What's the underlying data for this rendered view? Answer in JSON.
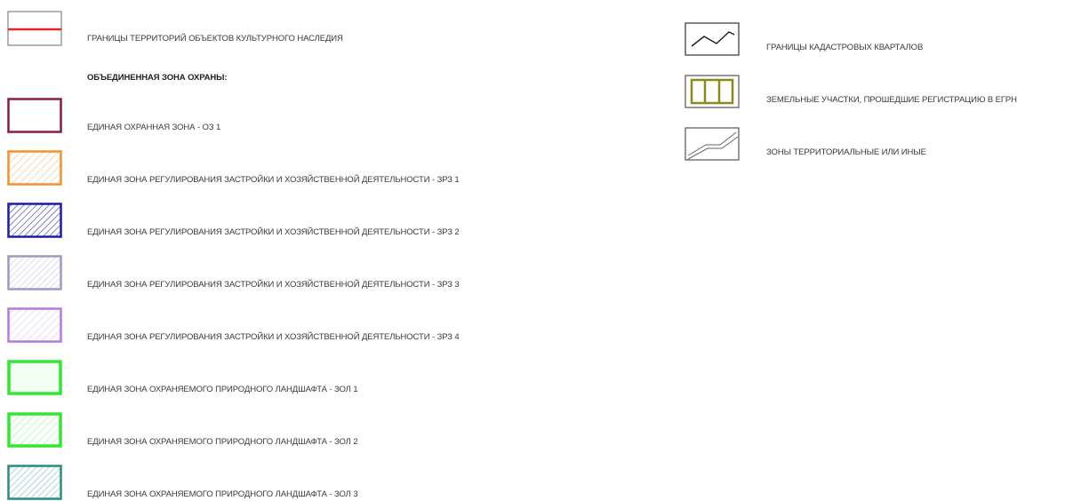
{
  "legend": {
    "heading": "ОБЪЕДИНЕННАЯ ЗОНА ОХРАНЫ:",
    "left_items": [
      {
        "label": "ГРАНИЦЫ ТЕРРИТОРИЙ ОБЪЕКТОВ КУЛЬТУРНОГО НАСЛЕДИЯ",
        "symbol": "red-line-boundary",
        "color": "#e4262b"
      },
      {
        "label": "ЕДИНАЯ ОХРАННАЯ ЗОНА - ОЗ 1",
        "symbol": "outlined-box",
        "color": "#8b1a4a"
      },
      {
        "label": "ЕДИНАЯ ЗОНА РЕГУЛИРОВАНИЯ ЗАСТРОЙКИ И ХОЗЯЙСТВЕННОЙ ДЕЯТЕЛЬНОСТИ - ЗРЗ 1",
        "symbol": "hatched-box",
        "color": "#f0922e"
      },
      {
        "label": "ЕДИНАЯ ЗОНА РЕГУЛИРОВАНИЯ ЗАСТРОЙКИ И ХОЗЯЙСТВЕННОЙ ДЕЯТЕЛЬНОСТИ - ЗРЗ 2",
        "symbol": "hatched-box",
        "color": "#1c1ca8"
      },
      {
        "label": "ЕДИНАЯ ЗОНА РЕГУЛИРОВАНИЯ ЗАСТРОЙКИ И ХОЗЯЙСТВЕННОЙ ДЕЯТЕЛЬНОСТИ - ЗРЗ 3",
        "symbol": "hatched-box",
        "color": "#9a9ac4"
      },
      {
        "label": "ЕДИНАЯ ЗОНА РЕГУЛИРОВАНИЯ ЗАСТРОЙКИ И ХОЗЯЙСТВЕННОЙ ДЕЯТЕЛЬНОСТИ - ЗРЗ 4",
        "symbol": "hatched-box",
        "color": "#b27ae0"
      },
      {
        "label": "ЕДИНАЯ ЗОНА ОХРАНЯЕМОГО ПРИРОДНОГО ЛАНДШАФТА - ЗОЛ 1",
        "symbol": "outlined-box",
        "color": "#33e633"
      },
      {
        "label": "ЕДИНАЯ ЗОНА ОХРАНЯЕМОГО ПРИРОДНОГО ЛАНДШАФТА - ЗОЛ 2",
        "symbol": "hatched-box",
        "color": "#33e633"
      },
      {
        "label": "ЕДИНАЯ ЗОНА ОХРАНЯЕМОГО ПРИРОДНОГО ЛАНДШАФТА - ЗОЛ 3",
        "symbol": "hatched-box",
        "color": "#2a8a82"
      }
    ],
    "right_items": [
      {
        "label": "ГРАНИЦЫ КАДАСТРОВЫХ КВАРТАЛОВ",
        "symbol": "zigzag-line",
        "color": "#222222"
      },
      {
        "label": "ЗЕМЕЛЬНЫЕ УЧАСТКИ, ПРОШЕДШИЕ РЕГИСТРАЦИЮ В ЕГРН",
        "symbol": "parcel-box",
        "color": "#8c8a1e"
      },
      {
        "label": "ЗОНЫ ТЕРРИТОРИАЛЬНЫЕ ИЛИ ИНЫЕ",
        "symbol": "double-line",
        "color": "#555555"
      }
    ]
  }
}
